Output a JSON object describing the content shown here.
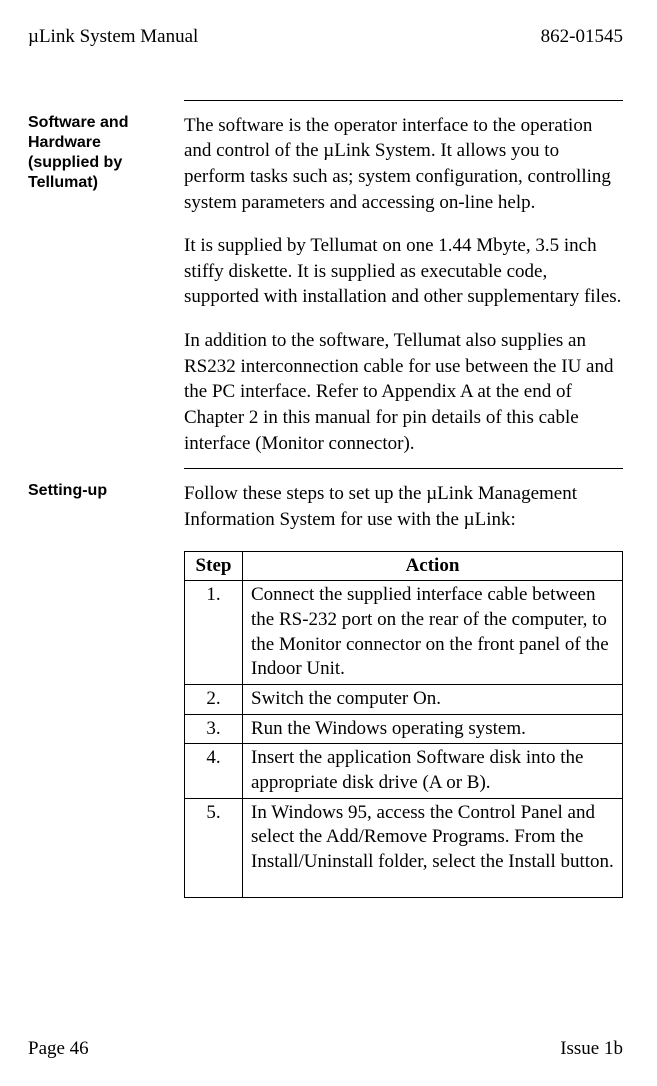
{
  "header": {
    "left": "µLink System Manual",
    "right": "862-01545"
  },
  "section1": {
    "side": "Software and Hardware (supplied by Tellumat)",
    "paras": [
      "The software is the operator interface to the operation and control of the µLink System.  It allows you to perform tasks such as; system configuration, controlling system parameters and accessing on-line help.",
      "It is supplied by Tellumat on one 1.44 Mbyte, 3.5 inch stiffy diskette.  It is supplied as executable code, supported with installation and other supplementary files.",
      "In addition to the software, Tellumat also supplies an RS232 interconnection cable for use between the IU and the PC interface.  Refer to Appendix A at the end of Chapter 2 in this manual for pin details of this cable interface (Monitor connector)."
    ]
  },
  "section2": {
    "side": "Setting-up",
    "intro": "Follow these steps to set up the µLink Management Information System for use with the µLink:",
    "table": {
      "headers": {
        "step": "Step",
        "action": "Action"
      },
      "rows": [
        {
          "step": "1.",
          "action": "Connect the supplied interface cable between the RS-232 port on the rear of the computer, to the Monitor connector on the front panel of the Indoor Unit."
        },
        {
          "step": "2.",
          "action": "Switch the computer On."
        },
        {
          "step": "3.",
          "action": "Run the Windows operating system."
        },
        {
          "step": "4.",
          "action": "Insert the application Software disk into the appropriate disk drive (A or B)."
        },
        {
          "step": "5.",
          "action": "In Windows 95, access the Control Panel and select the Add/Remove Programs.  From the Install/Uninstall folder, select the Install button."
        }
      ]
    }
  },
  "footer": {
    "left": "Page 46",
    "right": "Issue 1b"
  }
}
